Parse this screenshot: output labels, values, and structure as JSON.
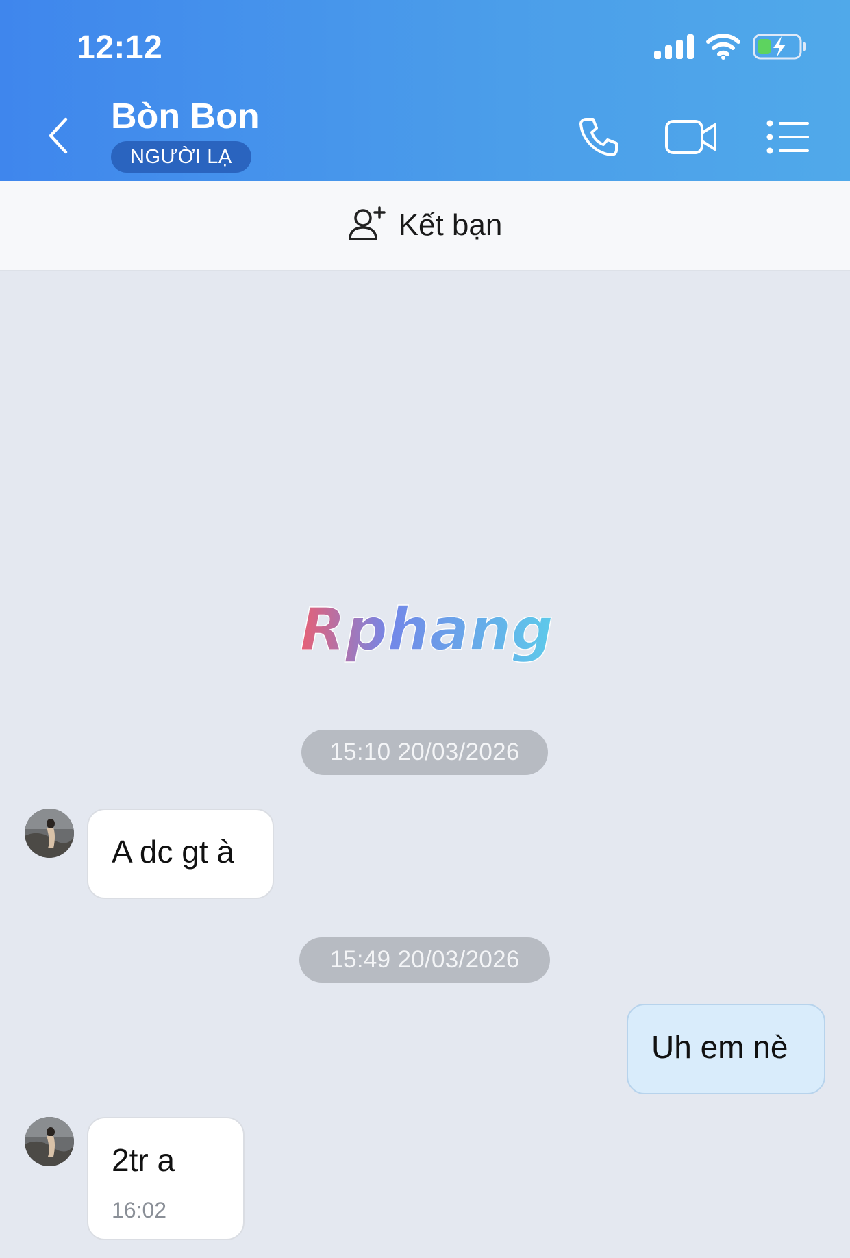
{
  "status_bar": {
    "time": "12:12",
    "icons": [
      "cellular-signal-icon",
      "wifi-icon",
      "battery-charging-icon"
    ]
  },
  "header": {
    "contact_name": "Bòn Bon",
    "badge": "NGƯỜI LẠ",
    "buttons": [
      "back-icon",
      "phone-icon",
      "video-camera-icon",
      "list-menu-icon"
    ],
    "gradient_colors": [
      "#3f86ed",
      "#50a9ea"
    ]
  },
  "add_friend": {
    "label": "Kết bạn",
    "icon": "add-friend-icon"
  },
  "watermark": {
    "text": "Rphang"
  },
  "messages": [
    {
      "type": "timestamp",
      "text": "15:10 20/03/2026"
    },
    {
      "type": "incoming",
      "text": "A dc gt à"
    },
    {
      "type": "timestamp",
      "text": "15:49 20/03/2026"
    },
    {
      "type": "outgoing",
      "text": "Uh em nè"
    },
    {
      "type": "incoming",
      "text": "2tr a",
      "time": "16:02"
    }
  ],
  "colors": {
    "chat_background": "#e4e8f0",
    "outgoing_bubble": "#d9ecfb",
    "incoming_bubble": "#ffffff",
    "badge": "#2a64bf"
  }
}
